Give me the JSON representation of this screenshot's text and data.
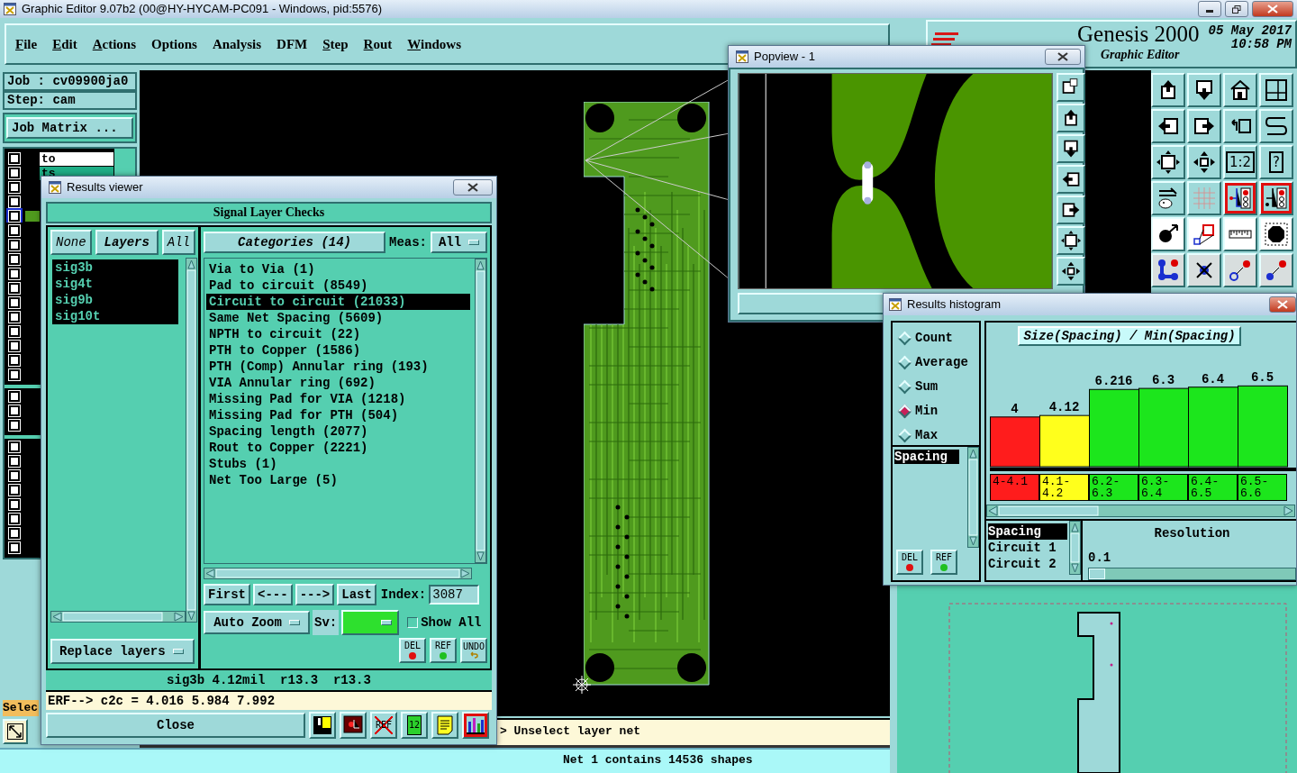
{
  "window": {
    "title": "Graphic Editor 9.07b2 (00@HY-HYCAM-PC091 - Windows, pid:5576)"
  },
  "menu": [
    {
      "label": "File",
      "underlined": true
    },
    {
      "label": "Edit",
      "underlined": true
    },
    {
      "label": "Actions",
      "underlined": true
    },
    {
      "label": "Options",
      "underlined": false
    },
    {
      "label": "Analysis",
      "underlined": false
    },
    {
      "label": "DFM",
      "underlined": false
    },
    {
      "label": "Step",
      "underlined": true
    },
    {
      "label": "Rout",
      "underlined": true
    },
    {
      "label": "Windows",
      "underlined": true
    }
  ],
  "header": {
    "product": "Genesis 2000",
    "date": "05 May 2017",
    "time": "10:58 PM",
    "subtitle": "Graphic Editor"
  },
  "job_panel": {
    "job": "Job : cv09900ja0",
    "step": "Step: cam",
    "matrix_button": "Job Matrix ...",
    "select_label": "Selec"
  },
  "layer_groups": [
    {
      "rows": [
        {
          "label": "to",
          "color": "#ffffff",
          "checked": false,
          "selected": false
        },
        {
          "label": "ts",
          "color": "#1fae86",
          "checked": false,
          "selected": false
        },
        {
          "checked": false,
          "selected": false
        },
        {
          "checked": false,
          "selected": false
        },
        {
          "color": "#4f9a1e",
          "checked": false,
          "selected": true
        },
        {
          "checked": false,
          "selected": false
        },
        {
          "checked": false,
          "selected": false
        },
        {
          "checked": false,
          "selected": false
        },
        {
          "checked": false,
          "selected": false
        },
        {
          "checked": false,
          "selected": false
        },
        {
          "checked": false,
          "selected": false
        },
        {
          "checked": false,
          "selected": false
        },
        {
          "checked": false,
          "selected": false
        },
        {
          "checked": false,
          "selected": false
        },
        {
          "checked": false,
          "selected": false
        },
        {
          "checked": false,
          "selected": false
        }
      ]
    },
    {
      "rows": [
        {
          "checked": false,
          "selected": false
        },
        {
          "checked": false,
          "selected": false
        },
        {
          "checked": false,
          "selected": false
        }
      ]
    },
    {
      "rows": [
        {
          "checked": false,
          "selected": false
        },
        {
          "checked": false,
          "selected": false
        },
        {
          "checked": false,
          "selected": false
        },
        {
          "checked": false,
          "selected": false
        },
        {
          "checked": false,
          "selected": false
        },
        {
          "checked": false,
          "selected": false
        },
        {
          "checked": false,
          "selected": false
        },
        {
          "checked": false,
          "selected": false
        }
      ]
    }
  ],
  "toolbar": [
    {
      "active": false
    },
    {
      "active": false
    },
    {
      "active": false
    },
    {
      "active": false
    },
    {
      "active": false
    },
    {
      "active": false
    },
    {
      "active": false
    },
    {
      "active": false
    },
    {
      "active": false
    },
    {
      "active": false
    },
    {
      "label": "1:2",
      "active": false
    },
    {
      "label": "?",
      "active": false
    },
    {
      "active": false
    },
    {
      "active": false
    },
    {
      "active": true
    },
    {
      "active": true
    },
    {
      "active": false
    },
    {
      "active": false
    },
    {
      "active": false
    },
    {
      "active": false
    },
    {
      "active": false
    },
    {
      "active": false
    },
    {
      "active": false
    },
    {
      "active": false
    }
  ],
  "popview": {
    "title": "Popview - 1"
  },
  "results_viewer": {
    "title": "Results viewer",
    "heading": "Signal Layer Checks",
    "layer_buttons": [
      {
        "label": "None",
        "bold": false
      },
      {
        "label": "Layers",
        "bold": true
      },
      {
        "label": "All",
        "bold": false
      }
    ],
    "categories_button": "Categories (14)",
    "meas_label": "Meas:",
    "meas_value": "All",
    "layers": [
      {
        "label": "sig3b",
        "selected": true
      },
      {
        "label": "sig4t",
        "selected": true
      },
      {
        "label": "sig9b",
        "selected": true
      },
      {
        "label": "sig10t",
        "selected": true
      }
    ],
    "categories": [
      {
        "label": "Via to Via (1)",
        "selected": false
      },
      {
        "label": "Pad to circuit (8549)",
        "selected": false
      },
      {
        "label": "Circuit to circuit (21033)",
        "selected": true
      },
      {
        "label": "Same Net Spacing (5609)",
        "selected": false
      },
      {
        "label": "NPTH to circuit (22)",
        "selected": false
      },
      {
        "label": "PTH to Copper (1586)",
        "selected": false
      },
      {
        "label": "PTH (Comp) Annular ring (193)",
        "selected": false
      },
      {
        "label": "VIA Annular ring (692)",
        "selected": false
      },
      {
        "label": "Missing Pad for VIA (1218)",
        "selected": false
      },
      {
        "label": "Missing Pad for PTH (504)",
        "selected": false
      },
      {
        "label": "Spacing length (2077)",
        "selected": false
      },
      {
        "label": "Rout to Copper (2221)",
        "selected": false
      },
      {
        "label": "Stubs (1)",
        "selected": false
      },
      {
        "label": "Net Too Large (5)",
        "selected": false
      }
    ],
    "nav": [
      "First",
      "<---",
      "--->",
      "Last"
    ],
    "index_label": "Index:",
    "index_value": "3087",
    "zoom": "Auto Zoom",
    "sv_label": "Sv:",
    "show_all": {
      "label": "Show All",
      "checked": false
    },
    "replace": "Replace layers",
    "actions": [
      "DEL",
      "REF",
      "UNDO"
    ],
    "info": "sig3b 4.12mil  r13.3  r13.3",
    "erf": "ERF--> c2c = 4.016 5.984 7.992",
    "close": "Close",
    "tools": [
      {
        "active": false
      },
      {
        "active": false
      },
      {
        "label": "REF",
        "active": false
      },
      {
        "label": "12",
        "active": false
      },
      {
        "active": false
      },
      {
        "active": true
      }
    ]
  },
  "histogram": {
    "title": "Results histogram",
    "modes": [
      {
        "label": "Count",
        "selected": false
      },
      {
        "label": "Average",
        "selected": false
      },
      {
        "label": "Sum",
        "selected": false
      },
      {
        "label": "Min",
        "selected": true
      },
      {
        "label": "Max",
        "selected": false
      }
    ],
    "list": [
      {
        "label": "Spacing",
        "selected": true
      }
    ],
    "buttons": [
      "DEL",
      "REF"
    ],
    "chart_data": {
      "type": "bar",
      "title": "Size(Spacing) / Min(Spacing)",
      "categories": [
        "4-4.1",
        "4.1-4.2",
        "6.2-6.3",
        "6.3-6.4",
        "6.4-6.5",
        "6.5-6.6"
      ],
      "stacked": true,
      "data_labels": true,
      "series": [
        {
          "color": "#ff1c1c",
          "values": [
            4,
            null,
            null,
            null,
            null,
            null
          ]
        },
        {
          "color": "#ffff1c",
          "values": [
            null,
            4.12,
            null,
            null,
            null,
            null
          ]
        },
        {
          "color": "#1ce61c",
          "values": [
            null,
            null,
            6.216,
            6.3,
            6.4,
            6.5
          ]
        }
      ]
    },
    "fields": [
      {
        "label": "Spacing",
        "selected": true
      },
      {
        "label": "Circuit 1",
        "selected": false
      },
      {
        "label": "Circuit 2",
        "selected": false
      }
    ],
    "resolution": {
      "label": "Resolution",
      "value": "0.1",
      "level": 0.08
    }
  },
  "command_line": "> Unselect layer net",
  "status_bar": "Net 1 contains 14536 shapes"
}
